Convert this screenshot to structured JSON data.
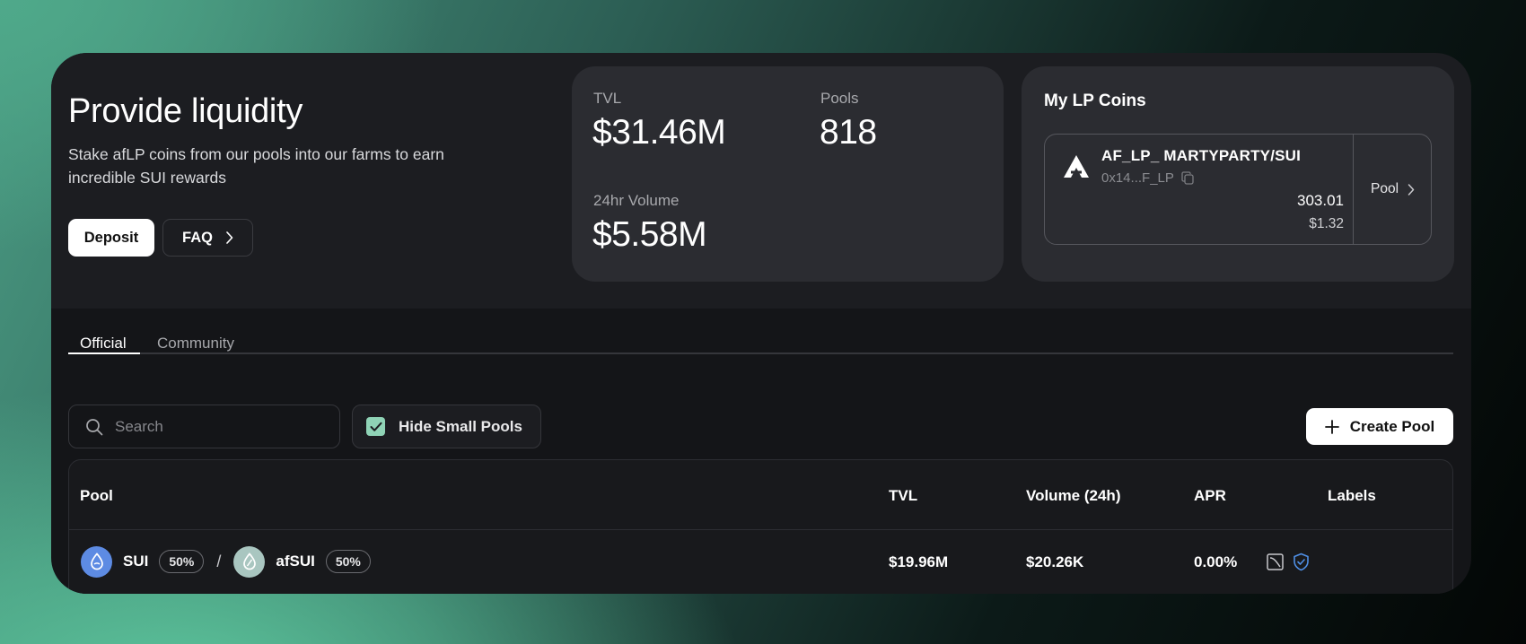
{
  "hero": {
    "title": "Provide liquidity",
    "description": "Stake afLP coins from our pools into our farms to earn incredible SUI rewards",
    "deposit_label": "Deposit",
    "faq_label": "FAQ"
  },
  "stats": {
    "tvl_label": "TVL",
    "tvl_value": "$31.46M",
    "pools_label": "Pools",
    "pools_value": "818",
    "volume_label": "24hr Volume",
    "volume_value": "$5.58M"
  },
  "lp_coins": {
    "title": "My LP Coins",
    "items": [
      {
        "name": "AF_LP_ MARTYPARTY/SUI",
        "address": "0x14...F_LP",
        "amount": "303.01",
        "usd": "$1.32",
        "pool_link": "Pool"
      }
    ]
  },
  "tabs": [
    {
      "label": "Official",
      "active": true
    },
    {
      "label": "Community",
      "active": false
    }
  ],
  "filters": {
    "search_placeholder": "Search",
    "hide_small_label": "Hide Small Pools",
    "hide_small_checked": true,
    "create_pool_label": "Create Pool"
  },
  "table": {
    "headers": {
      "pool": "Pool",
      "tvl": "TVL",
      "volume": "Volume (24h)",
      "apr": "APR",
      "labels": "Labels"
    },
    "rows": [
      {
        "coin_a": "SUI",
        "coin_a_weight": "50%",
        "separator": "/",
        "coin_b": "afSUI",
        "coin_b_weight": "50%",
        "tvl": "$19.96M",
        "volume": "$20.26K",
        "apr": "0.00%",
        "labels": [
          "stable-icon",
          "verified-shield-icon"
        ]
      }
    ]
  },
  "colors": {
    "card_bg": "#141518",
    "panel_bg": "#2b2c31",
    "accent_green": "#8fd3b6",
    "sui_blue": "#5d8be3",
    "verified_blue": "#4f8fe6"
  }
}
